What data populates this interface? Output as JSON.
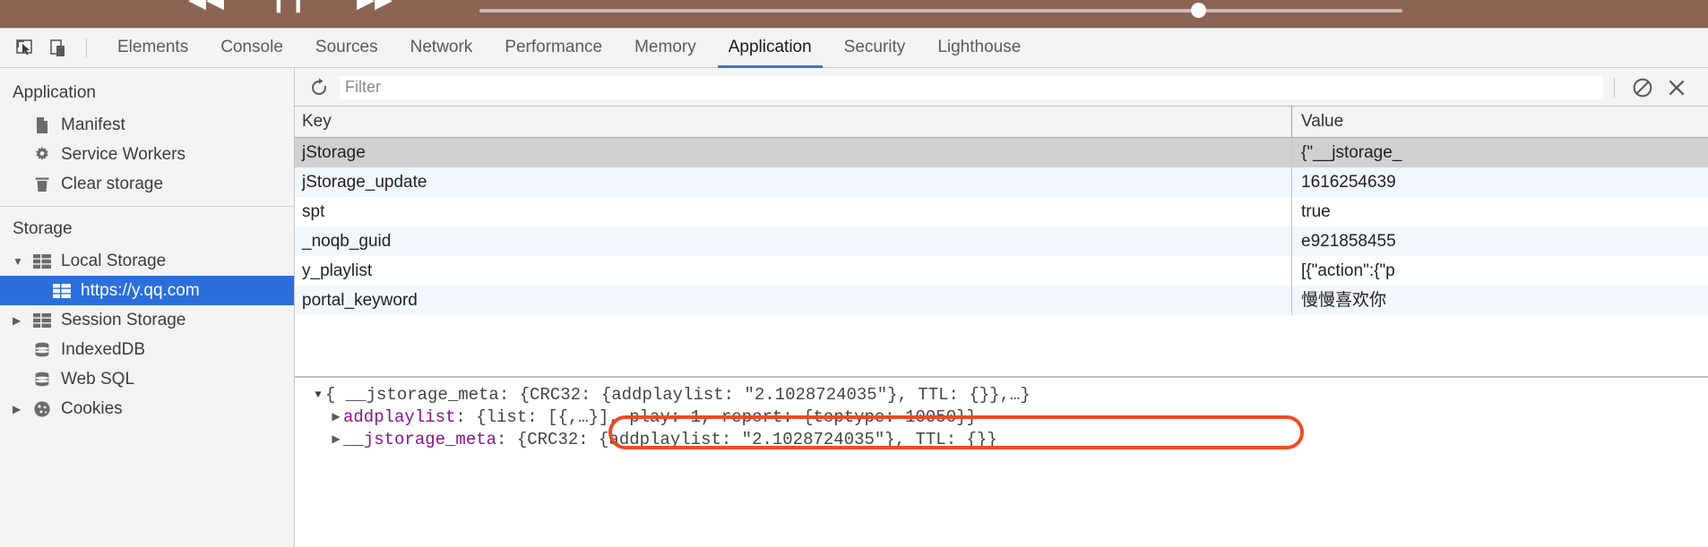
{
  "media_bar": {
    "prev_icon": "skip-previous-icon",
    "play_icon": "pause-icon",
    "next_icon": "skip-next-icon"
  },
  "devtools": {
    "inspect_icon": "inspect-element-icon",
    "device_icon": "device-toolbar-icon",
    "tabs": [
      {
        "label": "Elements",
        "active": false
      },
      {
        "label": "Console",
        "active": false
      },
      {
        "label": "Sources",
        "active": false
      },
      {
        "label": "Network",
        "active": false
      },
      {
        "label": "Performance",
        "active": false
      },
      {
        "label": "Memory",
        "active": false
      },
      {
        "label": "Application",
        "active": true
      },
      {
        "label": "Security",
        "active": false
      },
      {
        "label": "Lighthouse",
        "active": false
      }
    ],
    "accent_color": "#3f76c4"
  },
  "sidebar": {
    "sections": [
      {
        "title": "Application",
        "items": [
          {
            "label": "Manifest",
            "icon": "document-icon",
            "indent": 1,
            "arrow": "",
            "selected": false
          },
          {
            "label": "Service Workers",
            "icon": "gear-icon",
            "indent": 1,
            "arrow": "",
            "selected": false
          },
          {
            "label": "Clear storage",
            "icon": "trash-icon",
            "indent": 1,
            "arrow": "",
            "selected": false
          }
        ]
      },
      {
        "title": "Storage",
        "items": [
          {
            "label": "Local Storage",
            "icon": "table-icon",
            "indent": 1,
            "arrow": "▼",
            "selected": false
          },
          {
            "label": "https://y.qq.com",
            "icon": "table-icon",
            "indent": 2,
            "arrow": "",
            "selected": true
          },
          {
            "label": "Session Storage",
            "icon": "table-icon",
            "indent": 1,
            "arrow": "▶",
            "selected": false
          },
          {
            "label": "IndexedDB",
            "icon": "database-icon",
            "indent": 1,
            "arrow": "",
            "selected": false
          },
          {
            "label": "Web SQL",
            "icon": "database-icon",
            "indent": 1,
            "arrow": "",
            "selected": false
          },
          {
            "label": "Cookies",
            "icon": "cookie-icon",
            "indent": 1,
            "arrow": "▶",
            "selected": false
          }
        ]
      }
    ],
    "selected_color": "#2a6fdb"
  },
  "toolbar": {
    "refresh_icon": "refresh-icon",
    "filter_placeholder": "Filter",
    "filter_value": "",
    "clear_icon": "no-entry-icon",
    "close_icon": "close-icon"
  },
  "table": {
    "columns": [
      "Key",
      "Value"
    ],
    "rows": [
      {
        "key": "jStorage",
        "value": "{\"__jstorage_",
        "state": "selected"
      },
      {
        "key": "jStorage_update",
        "value": "1616254639",
        "state": "odd"
      },
      {
        "key": "spt",
        "value": "true",
        "state": "even"
      },
      {
        "key": "_noqb_guid",
        "value": "e921858455",
        "state": "odd"
      },
      {
        "key": "y_playlist",
        "value": "[{\"action\":{\"p",
        "state": "even"
      },
      {
        "key": "portal_keyword",
        "value": "慢慢喜欢你",
        "state": "odd"
      }
    ]
  },
  "preview": {
    "lines": [
      {
        "triangle": "▼",
        "triangle_open": true,
        "indent": 1,
        "segments": [
          {
            "text": "{ __jstorage_meta: {CRC32: {addplaylist: \"2.1028724035\"}, TTL: {}},…}",
            "style": "grey"
          }
        ]
      },
      {
        "triangle": "▶",
        "triangle_open": false,
        "indent": 2,
        "highlighted": true,
        "segments": [
          {
            "text": "addplaylist",
            "style": "purple"
          },
          {
            "text": ": {list: [{,…}], play: 1, report: {toptype: 10050}}",
            "style": "grey"
          }
        ]
      },
      {
        "triangle": "▶",
        "triangle_open": false,
        "indent": 2,
        "segments": [
          {
            "text": "__jstorage_meta",
            "style": "purple"
          },
          {
            "text": ": {CRC32: {addplaylist: \"2.1028724035\"}, TTL: {}}",
            "style": "grey"
          }
        ]
      }
    ],
    "highlight_color": "#f04a23",
    "key_color": "#881391"
  }
}
